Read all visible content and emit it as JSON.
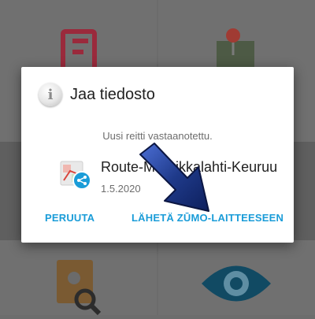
{
  "dialog": {
    "title": "Jaa tiedosto",
    "message": "Uusi reitti vastaanotettu.",
    "file": {
      "name": "Route-Muurikkalahti-Keuruu",
      "date": "1.5.2020"
    },
    "cancel_label": "PERUUTA",
    "send_label": "LÄHETÄ ZŪMO-LAITTEESEEN"
  },
  "colors": {
    "accent": "#1a9cd8",
    "arrow": "#1f3a8a",
    "scrim": "#6b6b6b"
  },
  "icons": {
    "info": "info-icon",
    "file": "map-share-icon",
    "pointer": "pointer-arrow-icon",
    "bg_top_left": "foursquare-icon",
    "bg_top_right": "map-pin-icon",
    "bg_bottom_left": "contacts-search-icon",
    "bg_bottom_right": "eye-icon"
  }
}
